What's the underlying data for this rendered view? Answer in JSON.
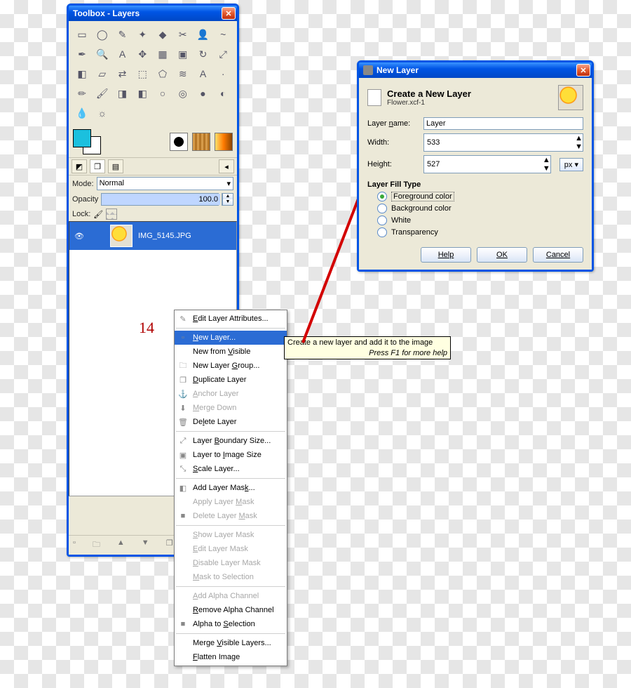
{
  "toolbox": {
    "title": "Toolbox - Layers",
    "mode_label": "Mode:",
    "mode_value": "Normal",
    "opacity_label": "Opacity",
    "opacity_value": "100.0",
    "lock_label": "Lock:",
    "layer": {
      "name": "IMG_5145.JPG"
    },
    "tools": [
      "rect-select",
      "ellipse-select",
      "free-select",
      "fuzzy-select",
      "by-color-select",
      "scissors",
      "foreground-select",
      "paths",
      "color-picker",
      "zoom",
      "measure",
      "move",
      "align",
      "crop",
      "rotate",
      "scale",
      "shear",
      "perspective",
      "flip",
      "cage",
      "text",
      "bucket-fill",
      "blend",
      "pencil",
      "paintbrush",
      "eraser",
      "airbrush",
      "ink",
      "clone",
      "heal",
      "perspective-clone",
      "blur-sharpen",
      "smudge",
      "dodge-burn"
    ],
    "tool_glyphs": [
      "▭",
      "◯",
      "✎",
      "✦",
      "◆",
      "✂",
      "👤",
      "~",
      "✒",
      "🔍",
      "A",
      "✥",
      "▦",
      "▣",
      "↻",
      "⤢",
      "◧",
      "▱",
      "⇄",
      "⬚",
      "⬠",
      "≋",
      "A",
      "·",
      "✏",
      "🖌",
      "◨",
      "◧",
      "○",
      "◎",
      "●",
      "◐",
      "💧",
      "☼"
    ]
  },
  "context_menu": {
    "items": [
      {
        "label": "Edit Layer Attributes...",
        "u": "E",
        "icon": "✎",
        "en": true
      },
      {
        "sep": true
      },
      {
        "label": "New Layer...",
        "u": "N",
        "icon": "▫",
        "en": true,
        "sel": true
      },
      {
        "label": "New from Visible",
        "u": "V",
        "icon": "",
        "en": true
      },
      {
        "label": "New Layer Group...",
        "u": "G",
        "icon": "🗀",
        "en": true
      },
      {
        "label": "Duplicate Layer",
        "u": "D",
        "icon": "❐",
        "en": true
      },
      {
        "label": "Anchor Layer",
        "u": "A",
        "icon": "⚓",
        "en": false
      },
      {
        "label": "Merge Down",
        "u": "M",
        "icon": "⬇",
        "en": false
      },
      {
        "label": "Delete Layer",
        "u": "l",
        "icon": "🗑",
        "en": true
      },
      {
        "sep": true
      },
      {
        "label": "Layer Boundary Size...",
        "u": "B",
        "icon": "⤢",
        "en": true
      },
      {
        "label": "Layer to Image Size",
        "u": "I",
        "icon": "▣",
        "en": true
      },
      {
        "label": "Scale Layer...",
        "u": "S",
        "icon": "⤡",
        "en": true
      },
      {
        "sep": true
      },
      {
        "label": "Add Layer Mask...",
        "u": "k",
        "icon": "◧",
        "en": true
      },
      {
        "label": "Apply Layer Mask",
        "u": "M",
        "icon": "",
        "en": false
      },
      {
        "label": "Delete Layer Mask",
        "u": "M",
        "icon": "■",
        "en": false
      },
      {
        "sep": true
      },
      {
        "label": "Show Layer Mask",
        "u": "S",
        "icon": "",
        "en": false
      },
      {
        "label": "Edit Layer Mask",
        "u": "E",
        "icon": "",
        "en": false
      },
      {
        "label": "Disable Layer Mask",
        "u": "D",
        "icon": "",
        "en": false
      },
      {
        "label": "Mask to Selection",
        "u": "M",
        "icon": "",
        "en": false
      },
      {
        "sep": true
      },
      {
        "label": "Add Alpha Channel",
        "u": "A",
        "icon": "",
        "en": false
      },
      {
        "label": "Remove Alpha Channel",
        "u": "R",
        "icon": "",
        "en": true
      },
      {
        "label": "Alpha to Selection",
        "u": "S",
        "icon": "■",
        "en": true
      },
      {
        "sep": true
      },
      {
        "label": "Merge Visible Layers...",
        "u": "V",
        "icon": "",
        "en": true
      },
      {
        "label": "Flatten Image",
        "u": "F",
        "icon": "",
        "en": true
      }
    ]
  },
  "tooltip": {
    "line1": "Create a new layer and add it to the image",
    "line2": "Press F1 for more help"
  },
  "dialog": {
    "title": "New Layer",
    "header_title": "Create a New Layer",
    "header_sub": "Flower.xcf-1",
    "name_label": "Layer name:",
    "name_value": "Layer",
    "width_label": "Width:",
    "width_value": "533",
    "height_label": "Height:",
    "height_value": "527",
    "unit": "px",
    "fill_section": "Layer Fill Type",
    "fill_options": [
      "Foreground color",
      "Background color",
      "White",
      "Transparency"
    ],
    "fill_selected": 0,
    "help": "Help",
    "ok": "OK",
    "cancel": "Cancel"
  },
  "callout": "14"
}
